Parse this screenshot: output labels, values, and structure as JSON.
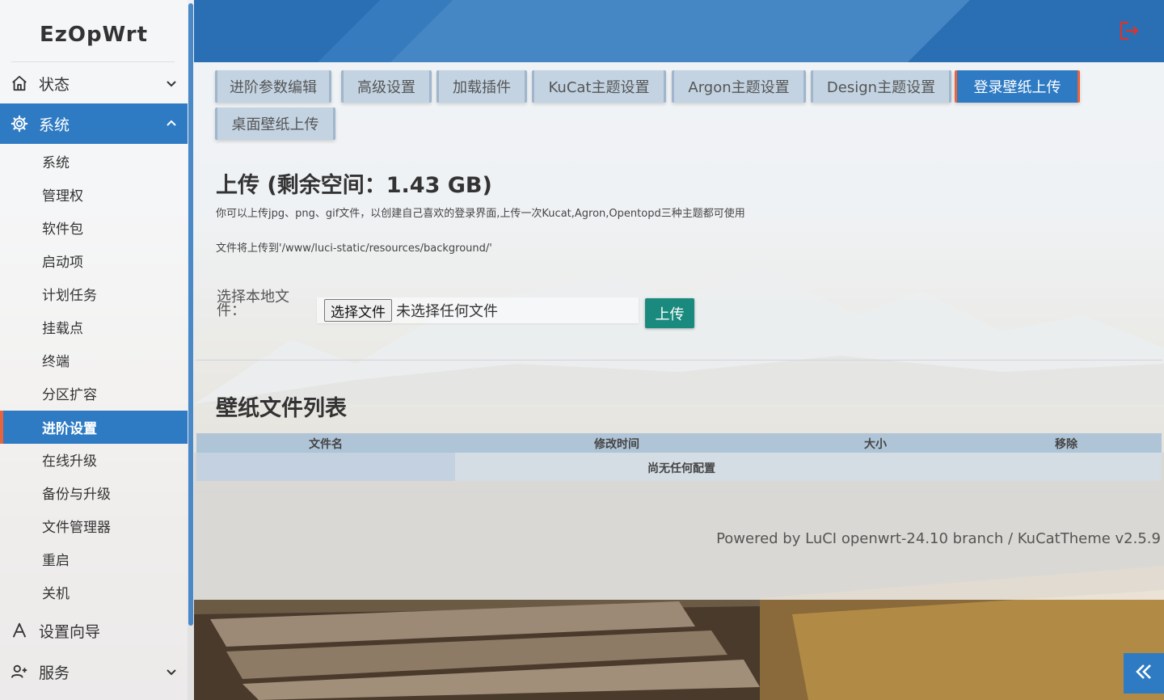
{
  "app": {
    "brand": "EzOpWrt"
  },
  "sidebar": {
    "status": {
      "label": "状态",
      "icon": "home-icon"
    },
    "system": {
      "label": "系统",
      "icon": "gear-icon",
      "items": [
        "系统",
        "管理权",
        "软件包",
        "启动项",
        "计划任务",
        "挂载点",
        "终端",
        "分区扩容",
        "进阶设置",
        "在线升级",
        "备份与升级",
        "文件管理器",
        "重启",
        "关机"
      ],
      "active_item": "进阶设置"
    },
    "wizard": {
      "label": "设置向导",
      "icon": "wizard-icon"
    },
    "services": {
      "label": "服务",
      "icon": "user-plus-icon"
    }
  },
  "header": {
    "logout_icon": "logout-icon",
    "logout_color": "#e0322b"
  },
  "tabs": [
    "进阶参数编辑",
    "高级设置",
    "加载插件",
    "KuCat主题设置",
    "Argon主题设置",
    "Design主题设置",
    "登录壁纸上传",
    "桌面壁纸上传"
  ],
  "active_tab": "登录壁纸上传",
  "upload": {
    "title": "上传 (剩余空间：1.43 GB)",
    "description": "你可以上传jpg、png、gif文件，以创建自己喜欢的登录界面,上传一次Kucat,Agron,Opentopd三种主题都可使用",
    "target_path": "文件将上传到'/www/luci-static/resources/background/'",
    "file_label": "选择本地文件：",
    "choose_button": "选择文件",
    "no_file": "未选择任何文件",
    "upload_button": "上传"
  },
  "wallpaper_list": {
    "title": "壁纸文件列表",
    "columns": [
      "文件名",
      "修改时间",
      "大小",
      "移除"
    ],
    "empty_text": "尚无任何配置"
  },
  "footer": {
    "text": "Powered by LuCI openwrt-24.10 branch / KuCatTheme v2.5.9"
  },
  "colors": {
    "accent": "#2e7bc4",
    "active_border": "#e8643c",
    "upload_button": "#1a8a7e"
  }
}
